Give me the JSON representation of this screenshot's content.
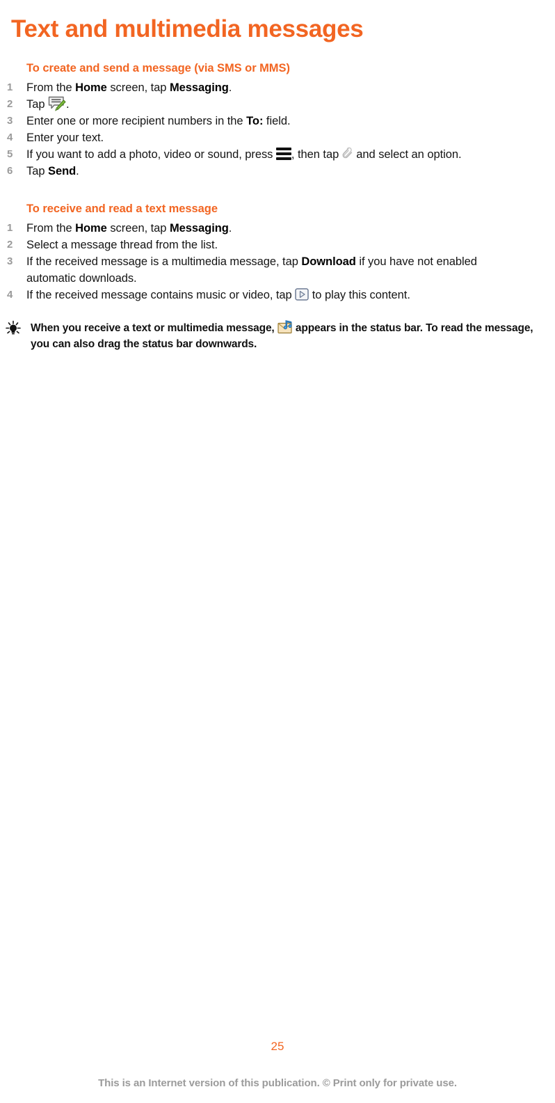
{
  "document": {
    "title": "Text and multimedia messages",
    "accent_color": "#F26522",
    "body_color": "#151515",
    "number_color": "#9a9a9a"
  },
  "sections": [
    {
      "heading": "To create and send a message (via SMS or MMS)",
      "steps": [
        {
          "number": "1",
          "parts": [
            {
              "t": "From the ",
              "b": false
            },
            {
              "t": "Home",
              "b": true
            },
            {
              "t": " screen, tap ",
              "b": false
            },
            {
              "t": "Messaging",
              "b": true
            },
            {
              "t": ".",
              "b": false
            }
          ]
        },
        {
          "number": "2",
          "parts": [
            {
              "t": "Tap ",
              "b": false
            },
            {
              "icon": "compose-icon"
            },
            {
              "t": ".",
              "b": false
            }
          ]
        },
        {
          "number": "3",
          "parts": [
            {
              "t": "Enter one or more recipient numbers in the ",
              "b": false
            },
            {
              "t": "To:",
              "b": true
            },
            {
              "t": " field.",
              "b": false
            }
          ]
        },
        {
          "number": "4",
          "parts": [
            {
              "t": "Enter your text.",
              "b": false
            }
          ]
        },
        {
          "number": "5",
          "parts": [
            {
              "t": "If you want to add a photo, video or sound, press ",
              "b": false
            },
            {
              "icon": "menu-icon"
            },
            {
              "t": ", then tap ",
              "b": false
            },
            {
              "icon": "paperclip-icon"
            },
            {
              "t": " and select an option.",
              "b": false
            }
          ]
        },
        {
          "number": "6",
          "parts": [
            {
              "t": "Tap ",
              "b": false
            },
            {
              "t": "Send",
              "b": true
            },
            {
              "t": ".",
              "b": false
            }
          ]
        }
      ]
    },
    {
      "heading": "To receive and read a text message",
      "steps": [
        {
          "number": "1",
          "parts": [
            {
              "t": "From the ",
              "b": false
            },
            {
              "t": "Home",
              "b": true
            },
            {
              "t": " screen, tap ",
              "b": false
            },
            {
              "t": "Messaging",
              "b": true
            },
            {
              "t": ".",
              "b": false
            }
          ]
        },
        {
          "number": "2",
          "parts": [
            {
              "t": "Select a message thread from the list.",
              "b": false
            }
          ]
        },
        {
          "number": "3",
          "parts": [
            {
              "t": "If the received message is a multimedia message, tap ",
              "b": false
            },
            {
              "t": "Download",
              "b": true
            },
            {
              "t": " if you have not enabled automatic downloads.",
              "b": false
            }
          ]
        },
        {
          "number": "4",
          "parts": [
            {
              "t": "If the received message contains music or video, tap ",
              "b": false
            },
            {
              "icon": "play-icon"
            },
            {
              "t": " to play this content.",
              "b": false
            }
          ]
        }
      ]
    }
  ],
  "tip": {
    "icon": "lightbulb-icon",
    "parts": [
      {
        "t": "When you receive a text or multimedia message, ",
        "b": true
      },
      {
        "icon": "message-music-icon"
      },
      {
        "t": " appears in the status bar. To read the message, you can also drag the status bar downwards.",
        "b": true
      }
    ]
  },
  "footer": {
    "page_number": "25",
    "note": "This is an Internet version of this publication. © Print only for private use."
  }
}
